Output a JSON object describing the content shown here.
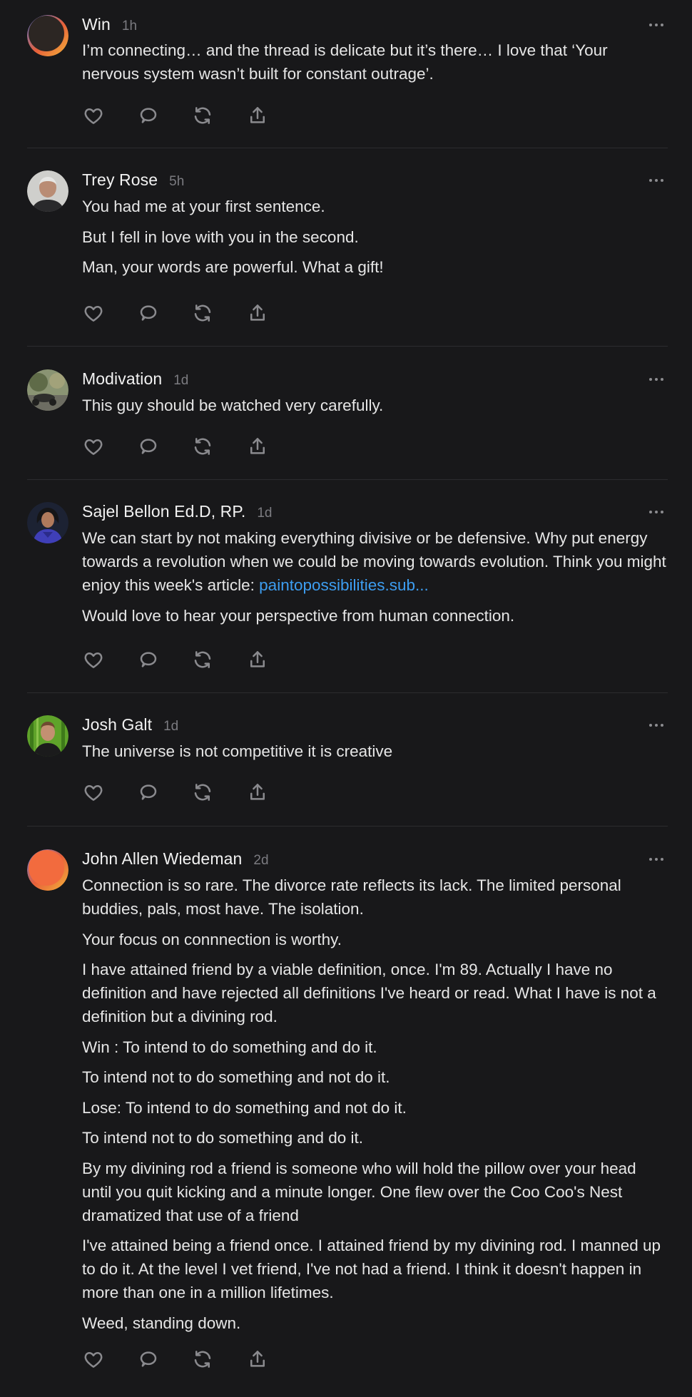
{
  "comments": [
    {
      "author": "Win",
      "time": "1h",
      "avatar": "avatar-orange-ring",
      "paragraphs": [
        "I’m connecting… and the thread is delicate but it’s there… I love that ‘Your nervous system wasn’t built for constant outrage’."
      ]
    },
    {
      "author": "Trey Rose",
      "time": "5h",
      "avatar": "avatar-photo-gray-hair",
      "paragraphs": [
        "You had me at your first sentence.",
        "But I fell in love with you in the second.",
        "Man, your words are powerful. What a gift!"
      ]
    },
    {
      "author": "Modivation",
      "time": "1d",
      "avatar": "avatar-photo-trees",
      "paragraphs": [
        "This guy should be watched very carefully."
      ]
    },
    {
      "author": "Sajel Bellon Ed.D, RP.",
      "time": "1d",
      "avatar": "avatar-photo-blue",
      "paragraphs": [
        "We can start by not making everything divisive or be defensive. Why put energy towards a revolution when we could be moving towards evolution. Think you might enjoy this week's article:",
        "Would love to hear your perspective from human connection."
      ],
      "link": "paintopossibilities.sub..."
    },
    {
      "author": "Josh Galt",
      "time": "1d",
      "avatar": "avatar-photo-green",
      "paragraphs": [
        "The universe is not competitive it is creative"
      ]
    },
    {
      "author": "John Allen Wiedeman",
      "time": "2d",
      "avatar": "avatar-orange-gradient",
      "paragraphs": [
        "Connection is so rare. The divorce rate reflects its lack. The limited personal buddies, pals, most have. The isolation.",
        "Your focus on connnection is worthy.",
        "I have attained friend by a viable definition, once. I'm 89. Actually I have no definition and have rejected all definitions I've heard or read. What I have is not a definition but a divining rod.",
        "Win : To intend to do something and do it.",
        "To intend not to do something and not do it.",
        "Lose: To intend to do something and not do it.",
        "To intend not to do something and do it.",
        "By my divining rod a friend is someone who will hold the pillow over your head until you quit kicking and a minute longer. One flew over the Coo Coo's Nest dramatized that use of a friend",
        "I've attained being a friend once. I attained friend by my divining rod. I manned up to do it. At the level I vet friend, I've not had a friend. I think it doesn't happen in more than one in a million lifetimes.",
        "Weed, standing down."
      ]
    }
  ],
  "actions": [
    "heart-icon",
    "reply-icon",
    "restack-icon",
    "share-icon"
  ],
  "colors": {
    "background": "#18181a",
    "text": "#e6e6e6",
    "muted": "#7b7b80",
    "link": "#3d9df0",
    "divider": "#2c2c2f"
  }
}
